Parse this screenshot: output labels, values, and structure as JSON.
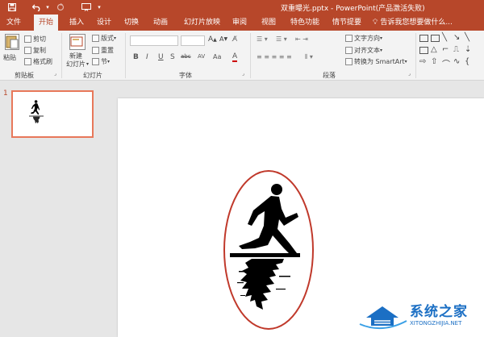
{
  "titlebar": {
    "title": "双重曝光.pptx - PowerPoint(产品激活失败)",
    "icons": [
      "save-icon",
      "undo-icon",
      "redo-icon",
      "presenter-icon"
    ]
  },
  "tabs": [
    {
      "label": "文件"
    },
    {
      "label": "开始",
      "active": true
    },
    {
      "label": "插入"
    },
    {
      "label": "设计"
    },
    {
      "label": "切换"
    },
    {
      "label": "动画"
    },
    {
      "label": "幻灯片放映"
    },
    {
      "label": "审阅"
    },
    {
      "label": "视图"
    },
    {
      "label": "特色功能"
    },
    {
      "label": "情节提要"
    }
  ],
  "tellme": "告诉我您想要做什么...",
  "ribbon": {
    "clipboard": {
      "paste": "粘贴",
      "cut": "剪切",
      "copy": "复制",
      "format_painter": "格式刷",
      "label": "剪贴板"
    },
    "slides": {
      "new_slide": "新建",
      "new_slide_2": "幻灯片",
      "layout": "版式",
      "reset": "重置",
      "section": "节",
      "label": "幻灯片"
    },
    "font": {
      "label": "字体",
      "buttons": [
        "B",
        "I",
        "U",
        "S",
        "abc",
        "AV",
        "Aa",
        "A"
      ]
    },
    "paragraph": {
      "text_direction": "文字方向",
      "align_text": "对齐文本",
      "smartart": "转换为 SmartArt",
      "label": "段落"
    }
  },
  "thumbs": {
    "slide_number": "1"
  },
  "watermark": {
    "text": "系统之家",
    "sub": "XITONGZHIJIA.NET"
  }
}
